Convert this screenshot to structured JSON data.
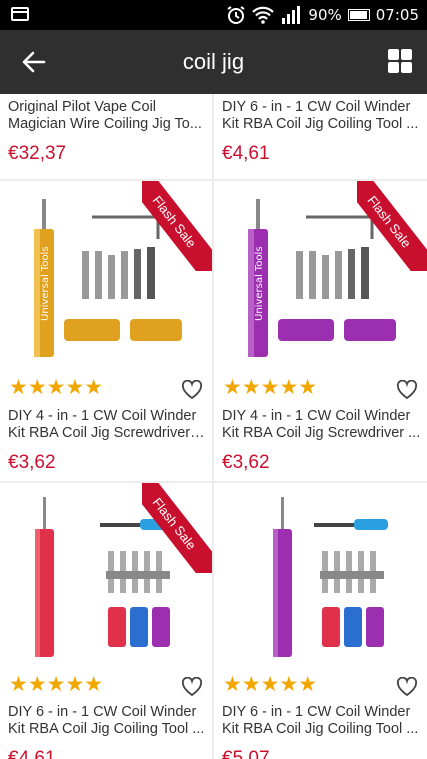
{
  "status_bar": {
    "battery": "90%",
    "time": "07:05"
  },
  "app_bar": {
    "title": "coil jig"
  },
  "products": [
    {
      "line1": "Original Pilot Vape Coil",
      "line2": "Magician Wire Coiling Jig To...",
      "price": "€32,37"
    },
    {
      "line1": "DIY 6 - in - 1 CW Coil Winder",
      "line2": "Kit RBA Coil Jig Coiling Tool ...",
      "price": "€4,61"
    },
    {
      "line1": "DIY 4 - in - 1 CW Coil Winder",
      "line2": "Kit RBA Coil Jig Screwdriver ...",
      "price": "€3,62",
      "badge": "Flash Sale",
      "rating": "★★★★★",
      "tool_text": "Universal Tools"
    },
    {
      "line1": "DIY 4 - in - 1 CW Coil Winder",
      "line2": "Kit RBA Coil Jig Screwdriver ...",
      "price": "€3,62",
      "badge": "Flash Sale",
      "rating": "★★★★★",
      "tool_text": "Universal Tools"
    },
    {
      "line1": "DIY 6 - in - 1 CW Coil Winder",
      "line2": "Kit RBA Coil Jig Coiling Tool ...",
      "price": "€4,61",
      "badge": "Flash Sale",
      "rating": "★★★★★"
    },
    {
      "line1": "DIY 6 - in - 1 CW Coil Winder",
      "line2": "Kit RBA Coil Jig Coiling Tool ...",
      "price": "€5,07",
      "rating": "★★★★★"
    }
  ],
  "colors": {
    "price": "#c8102e",
    "star": "#f2a700",
    "gold": "#e0a020",
    "purple": "#9b2fb0",
    "red": "#e0304a",
    "blue": "#2a6fd0"
  }
}
